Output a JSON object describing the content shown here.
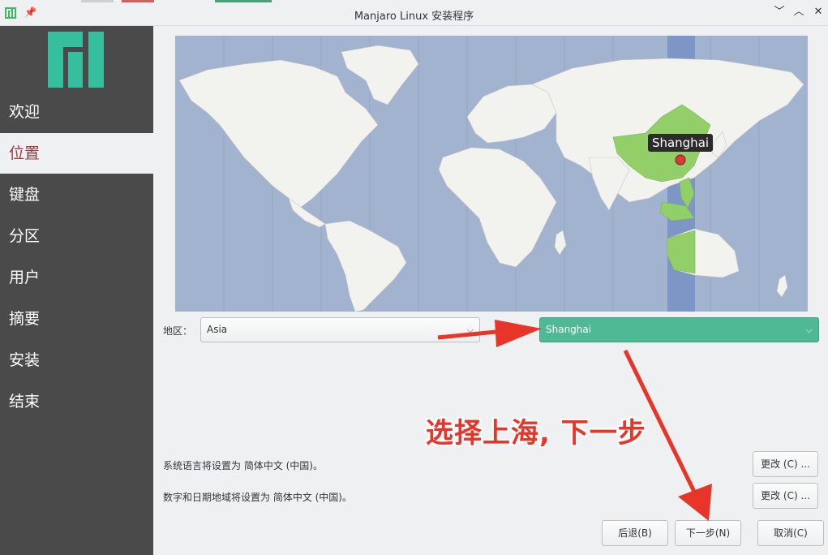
{
  "window": {
    "title": "Manjaro Linux 安装程序",
    "controls": {
      "menu": "﹀",
      "minimize": "︿",
      "close": "✕"
    }
  },
  "sidebar": {
    "items": [
      {
        "label": "欢迎",
        "active": false
      },
      {
        "label": "位置",
        "active": true
      },
      {
        "label": "键盘",
        "active": false
      },
      {
        "label": "分区",
        "active": false
      },
      {
        "label": "用户",
        "active": false
      },
      {
        "label": "摘要",
        "active": false
      },
      {
        "label": "安装",
        "active": false
      },
      {
        "label": "结束",
        "active": false
      }
    ]
  },
  "map": {
    "marker_label": "Shanghai",
    "colors": {
      "ocean": "#a2b3cf",
      "land": "#f2f2ef",
      "highlight": "#93cf68",
      "timezone_band": "#7e96c5"
    }
  },
  "location": {
    "region_label": "地区：",
    "region_value": "Asia",
    "zone_value": "Shanghai"
  },
  "settings": {
    "language_text": "系统语言将设置为 简体中文 (中国)。",
    "language_button": "更改 (C) ...",
    "locale_text": "数字和日期地域将设置为 简体中文 (中国)。",
    "locale_button": "更改 (C) ..."
  },
  "footer": {
    "back": "后退(B)",
    "next": "下一步(N)",
    "cancel": "取消(C)"
  },
  "annotation": {
    "text": "选择上海, 下一步",
    "color": "#e8352a"
  }
}
